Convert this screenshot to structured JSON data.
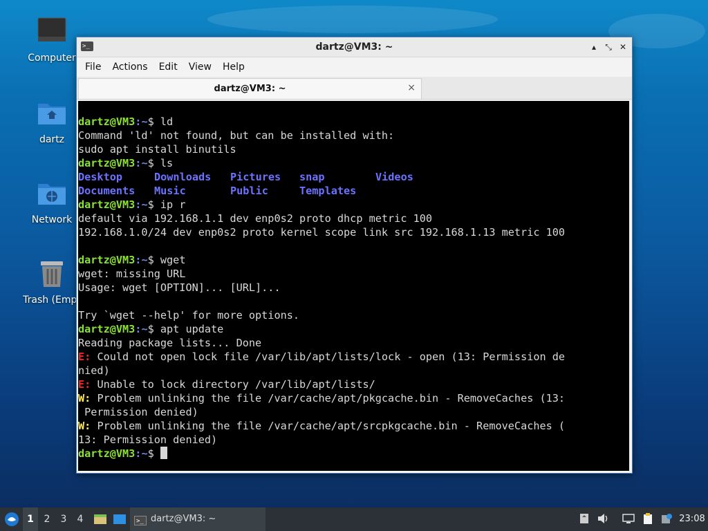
{
  "desktop": {
    "icons": [
      {
        "label": "Computer"
      },
      {
        "label": "dartz"
      },
      {
        "label": "Network"
      },
      {
        "label": "Trash (Empt"
      }
    ]
  },
  "window": {
    "title": "dartz@VM3: ~",
    "menu": [
      "File",
      "Actions",
      "Edit",
      "View",
      "Help"
    ],
    "tab_label": "dartz@VM3: ~",
    "tab_close": "×",
    "controls": {
      "minimize": "▴",
      "maximize": "⤡",
      "close": "✕"
    }
  },
  "terminal": {
    "prompt_user": "dartz@VM3",
    "prompt_path": ":~",
    "prompt_sign": "$ ",
    "cmd1": "ld",
    "out1a": "Command 'ld' not found, but can be installed with:",
    "out1b": "sudo apt install binutils",
    "cmd2": "ls",
    "ls": [
      [
        "Desktop",
        "Downloads",
        "Pictures",
        "snap",
        "Videos"
      ],
      [
        "Documents",
        "Music",
        "Public",
        "Templates"
      ]
    ],
    "cmd3": "ip r",
    "out3a": "default via 192.168.1.1 dev enp0s2 proto dhcp metric 100",
    "out3b": "192.168.1.0/24 dev enp0s2 proto kernel scope link src 192.168.1.13 metric 100",
    "cmd4": "wget",
    "out4a": "wget: missing URL",
    "out4b": "Usage: wget [OPTION]... [URL]...",
    "out4c": "Try `wget --help' for more options.",
    "cmd5": "apt update",
    "out5a": "Reading package lists... Done",
    "e_prefix": "E:",
    "w_prefix": "W:",
    "err1a": " Could not open lock file /var/lib/apt/lists/lock - open (13: Permission de",
    "err1b": "nied)",
    "err2": " Unable to lock directory /var/lib/apt/lists/",
    "warn1a": " Problem unlinking the file /var/cache/apt/pkgcache.bin - RemoveCaches (13:",
    "warn1b": " Permission denied)",
    "warn2a": " Problem unlinking the file /var/cache/apt/srcpkgcache.bin - RemoveCaches (",
    "warn2b": "13: Permission denied)"
  },
  "taskbar": {
    "workspaces": [
      "1",
      "2",
      "3",
      "4"
    ],
    "active_workspace": "1",
    "task_label": "dartz@VM3: ~",
    "clock": "23:08"
  },
  "colors": {
    "prompt_user": "#8ae234",
    "prompt_path": "#6d86e0",
    "directory": "#6b73ff",
    "error": "#ef2929",
    "warning": "#fce94f"
  }
}
